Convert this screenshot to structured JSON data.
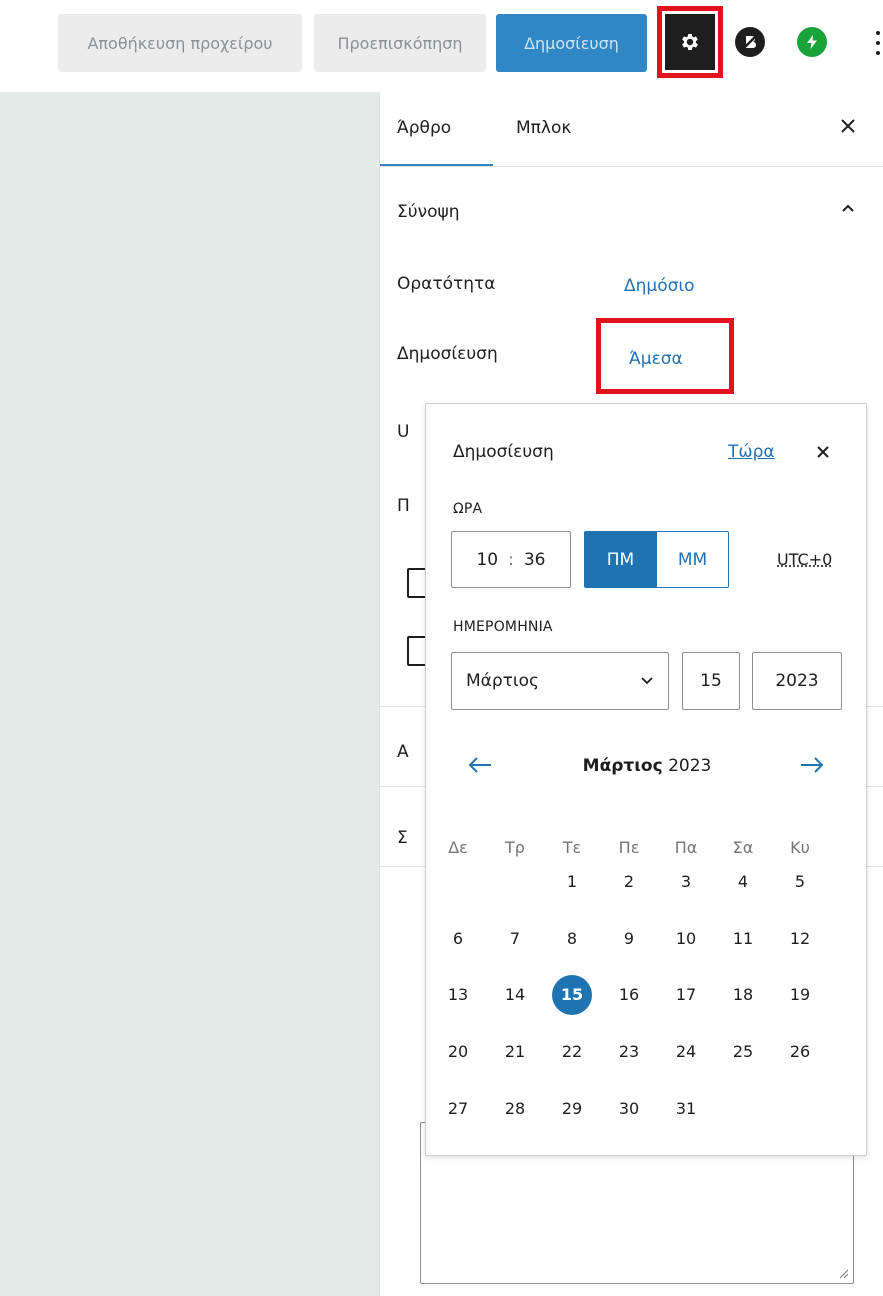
{
  "toolbar": {
    "save_draft": "Αποθήκευση προχείρου",
    "preview": "Προεπισκόπηση",
    "publish": "Δημοσίευση",
    "settings_icon": "gear-icon",
    "plugin_icon_1": "b-circle-icon",
    "plugin_icon_2": "bolt-icon",
    "more_icon": "more-vertical-icon"
  },
  "sidebar": {
    "tabs": [
      {
        "label": "Άρθρο",
        "active": true
      },
      {
        "label": "Μπλοκ",
        "active": false
      }
    ],
    "summary": {
      "title": "Σύνοψη",
      "visibility_label": "Ορατότητα",
      "visibility_value": "Δημόσιο",
      "publish_label": "Δημοσίευση",
      "publish_value": "Άμεσα"
    },
    "peek": {
      "row1": "U",
      "row2": "Π",
      "row3": "Α",
      "row4": "Σ"
    }
  },
  "popover": {
    "title": "Δημοσίευση",
    "now_link": "Τώρα",
    "time_label": "ΩΡΑ",
    "hours": "10",
    "minutes": "36",
    "pm": "ΠΜ",
    "am": "ΜΜ",
    "timezone": "UTC+0",
    "date_label": "ΗΜΕΡΟΜΗΝΙΑ",
    "month": "Μάρτιος",
    "day": "15",
    "year": "2023",
    "calendar": {
      "month_name": "Μάρτιος",
      "year": "2023",
      "weekdays": [
        "Δε",
        "Τρ",
        "Τε",
        "Πε",
        "Πα",
        "Σα",
        "Κυ"
      ],
      "weeks": [
        [
          "",
          "",
          "1",
          "2",
          "3",
          "4",
          "5"
        ],
        [
          "6",
          "7",
          "8",
          "9",
          "10",
          "11",
          "12"
        ],
        [
          "13",
          "14",
          "15",
          "16",
          "17",
          "18",
          "19"
        ],
        [
          "20",
          "21",
          "22",
          "23",
          "24",
          "25",
          "26"
        ],
        [
          "27",
          "28",
          "29",
          "30",
          "31",
          "",
          ""
        ]
      ],
      "selected": "15"
    }
  },
  "colors": {
    "accent": "#2271b1",
    "primary_button": "#1e73b0",
    "highlight_box": "#e0131e",
    "canvas_bg": "#e3ebe8"
  }
}
